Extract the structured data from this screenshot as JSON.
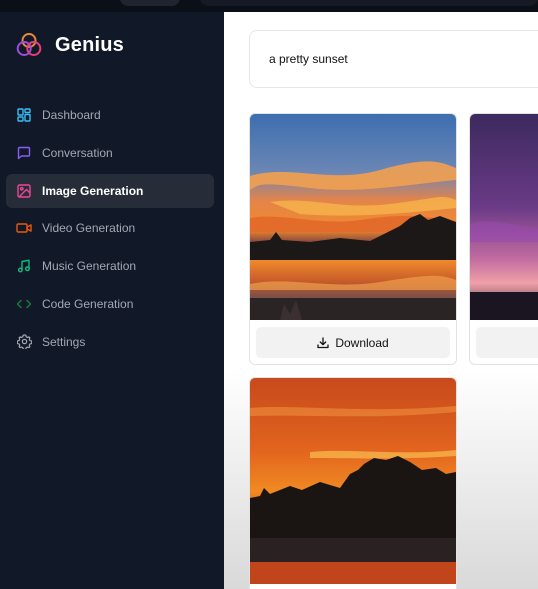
{
  "brand": {
    "name": "Genius"
  },
  "sidebar": {
    "items": [
      {
        "label": "Dashboard",
        "icon": "layout-dashboard-icon",
        "color": "#38bdf8",
        "active": false
      },
      {
        "label": "Conversation",
        "icon": "message-square-icon",
        "color": "#8b5cf6",
        "active": false
      },
      {
        "label": "Image Generation",
        "icon": "image-icon",
        "color": "#ec4899",
        "active": true
      },
      {
        "label": "Video Generation",
        "icon": "video-icon",
        "color": "#ea580c",
        "active": false
      },
      {
        "label": "Music Generation",
        "icon": "music-icon",
        "color": "#10b981",
        "active": false
      },
      {
        "label": "Code Generation",
        "icon": "code-icon",
        "color": "#15803d",
        "active": false
      },
      {
        "label": "Settings",
        "icon": "settings-icon",
        "color": "#a3a8b3",
        "active": false
      }
    ]
  },
  "main": {
    "prompt_value": "a pretty sunset",
    "download_label": "Download"
  }
}
